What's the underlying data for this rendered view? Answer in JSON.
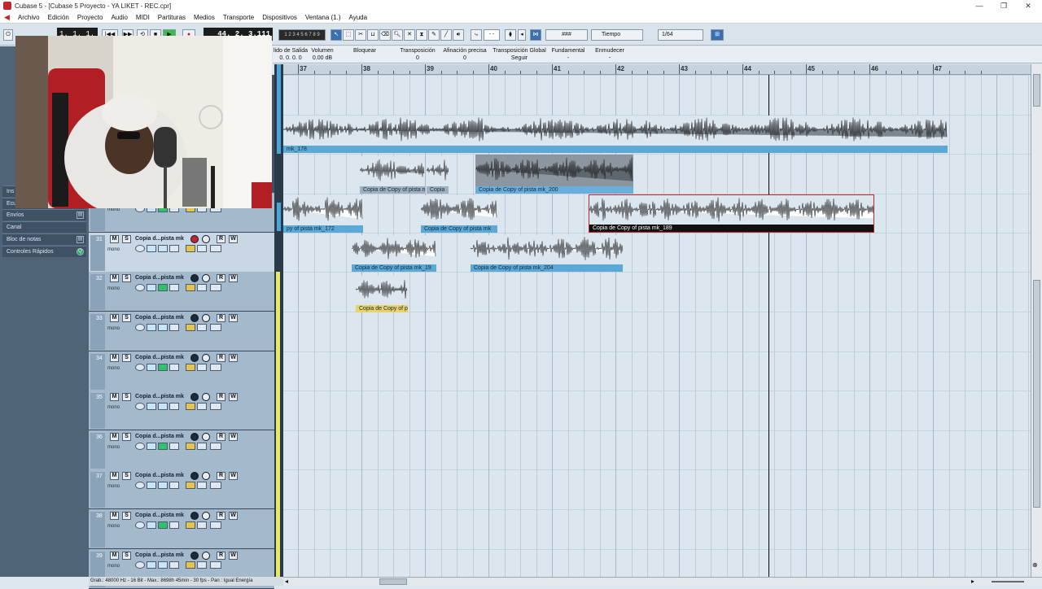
{
  "window": {
    "title": "Cubase 5 - [Cubase 5 Proyecto - YA LIKET - REC.cpr]"
  },
  "menu": [
    "Archivo",
    "Edición",
    "Proyecto",
    "Audio",
    "MIDI",
    "Partituras",
    "Medios",
    "Transporte",
    "Dispositivos",
    "Ventana (1.)",
    "Ayuda"
  ],
  "toolbar": {
    "counter_left": "1. 1. 1.",
    "counter_sub": "0",
    "position": "44. 2. 3.111",
    "snap_value": "- -",
    "grid_mode": "Tiempo",
    "quantize": "1/64"
  },
  "infoline": {
    "labels": [
      "lido de Salida",
      "Volumen",
      "Bloquear",
      "Transposición",
      "Afinación precisa",
      "Transposición Global",
      "Fundamental",
      "Enmudecer"
    ],
    "values": [
      "0. 0. 0.  0",
      "0.00 dB",
      "",
      "0",
      "0",
      "Seguir",
      "-",
      "-"
    ]
  },
  "ruler": {
    "bars": [
      "37",
      "38",
      "39",
      "40",
      "41",
      "42",
      "43",
      "44",
      "45",
      "46",
      "47"
    ]
  },
  "inspector": {
    "items": [
      {
        "label": "Ins",
        "icon": ""
      },
      {
        "label": "Ecu",
        "icon": ""
      },
      {
        "label": "Envíos",
        "icon": "▤"
      },
      {
        "label": "Canal",
        "icon": ""
      },
      {
        "label": "Bloc de notas",
        "icon": "▤"
      },
      {
        "label": "Controles Rápidos",
        "icon": "Q"
      }
    ]
  },
  "tracks": [
    {
      "num": "",
      "name": "",
      "mode": "mono",
      "selected": false,
      "armed": false
    },
    {
      "num": "31",
      "name": "Copia d...pista mk",
      "mode": "mono",
      "selected": true,
      "armed": true
    },
    {
      "num": "32",
      "name": "Copia d...pista mk",
      "mode": "mono",
      "selected": false,
      "armed": false
    },
    {
      "num": "33",
      "name": "Copia d...pista mk",
      "mode": "mono",
      "selected": false,
      "armed": false
    },
    {
      "num": "34",
      "name": "Copia d...pista mk",
      "mode": "mono",
      "selected": false,
      "armed": false
    },
    {
      "num": "35",
      "name": "Copia d...pista mk",
      "mode": "mono",
      "selected": false,
      "armed": false
    },
    {
      "num": "36",
      "name": "Copia d...pista mk",
      "mode": "mono",
      "selected": false,
      "armed": false
    },
    {
      "num": "37",
      "name": "Copia d...pista mk",
      "mode": "mono",
      "selected": false,
      "armed": false
    },
    {
      "num": "38",
      "name": "Copia d...pista mk",
      "mode": "mono",
      "selected": false,
      "armed": false
    },
    {
      "num": "39",
      "name": "Copia d...pista mk",
      "mode": "mono",
      "selected": false,
      "armed": false
    }
  ],
  "events": [
    {
      "label": "mk_178",
      "style": "blue"
    },
    {
      "label": "Copia de Copy of pista mk",
      "style": "gray"
    },
    {
      "label": "Copia",
      "style": "gray"
    },
    {
      "label": "Copia de Copy of pista mk_200",
      "style": "gray-sel"
    },
    {
      "label": "py of pista mk_172",
      "style": "blue"
    },
    {
      "label": "Copia de Copy of pista mk",
      "style": "blue"
    },
    {
      "label": "Copia de Copy of pista mk_189",
      "style": "selected"
    },
    {
      "label": "Copia de Copy of pista mk_19",
      "style": "blue"
    },
    {
      "label": "Copia de Copy of pista mk_204",
      "style": "blue"
    },
    {
      "label": "Copia de Copy of pi",
      "style": "yellow"
    }
  ],
  "statusbar": "Grab.: 48000 Hz - 16 Bit - Max.: 8698h 45min - 30 fps - Pan : Igual Energía",
  "colors": {
    "accent": "#4aa6d9",
    "record": "#c0272d",
    "selected_event": "#c0272d"
  }
}
